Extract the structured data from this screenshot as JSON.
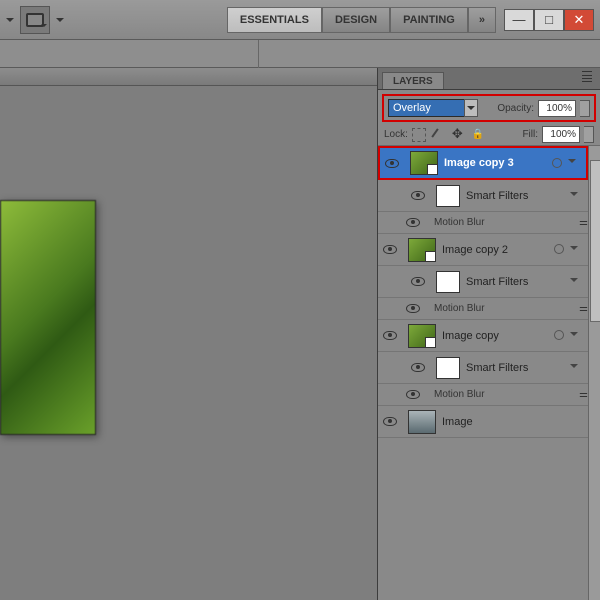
{
  "menubar": {
    "workspaces": [
      "ESSENTIALS",
      "DESIGN",
      "PAINTING"
    ],
    "expand": "»"
  },
  "panel": {
    "tab": "LAYERS",
    "blend_mode": "Overlay",
    "opacity_label": "Opacity:",
    "opacity_value": "100%",
    "lock_label": "Lock:",
    "fill_label": "Fill:",
    "fill_value": "100%"
  },
  "layers": [
    {
      "name": "Image copy 3",
      "selected": true,
      "smart": true,
      "thumb": "green"
    },
    {
      "name": "Smart Filters",
      "sub": true,
      "thumb": "white"
    },
    {
      "name": "Motion Blur",
      "effect": true
    },
    {
      "name": "Image copy 2",
      "smart": true,
      "thumb": "green"
    },
    {
      "name": "Smart Filters",
      "sub": true,
      "thumb": "white"
    },
    {
      "name": "Motion Blur",
      "effect": true
    },
    {
      "name": "Image copy",
      "smart": true,
      "thumb": "green"
    },
    {
      "name": "Smart Filters",
      "sub": true,
      "thumb": "white"
    },
    {
      "name": "Motion Blur",
      "effect": true
    },
    {
      "name": "Image",
      "thumb": "image"
    }
  ]
}
